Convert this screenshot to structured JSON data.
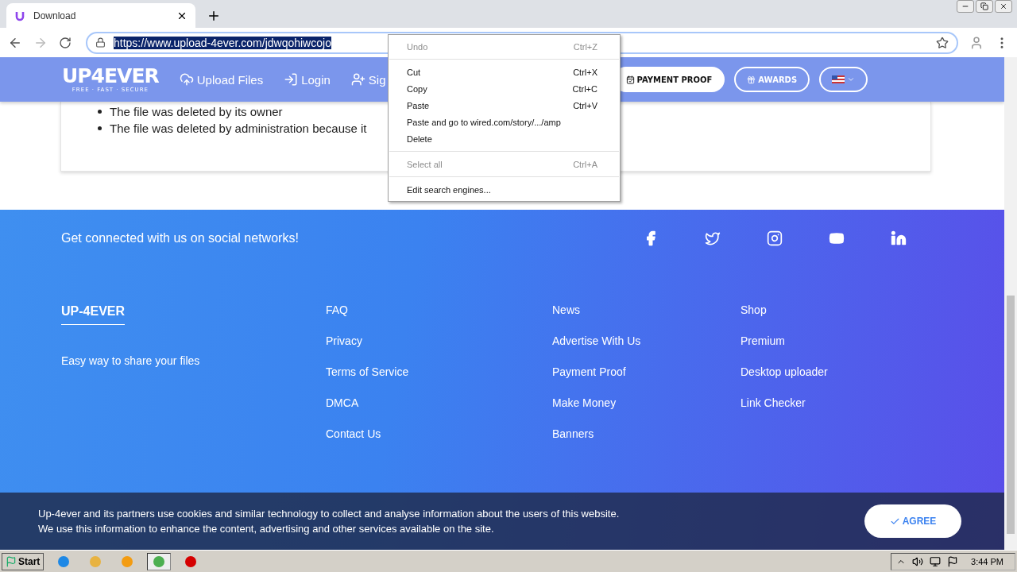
{
  "browser": {
    "tab": {
      "title": "Download",
      "selected": true
    },
    "url": "https://www.upload-4ever.com/jdwqohiwcojo",
    "url_selected": true
  },
  "header": {
    "logo": "UP4EVER",
    "tagline": "FREE · FAST · SECURE",
    "nav": [
      {
        "label": "Upload Files",
        "kind": "upload"
      },
      {
        "label": "Login",
        "kind": "login"
      },
      {
        "label": "Sig",
        "kind": "signup"
      }
    ],
    "pills": [
      {
        "label": "PAYMENT PROOF",
        "kind": "payment",
        "filled": true
      },
      {
        "label": "AWARDS",
        "kind": "awards",
        "filled": false
      },
      {
        "kind": "language",
        "filled": false
      }
    ]
  },
  "reasons": [
    "The file was deleted by its owner",
    "The file was deleted by administration because it"
  ],
  "context_menu": [
    {
      "label": "Undo",
      "shortcut": "Ctrl+Z",
      "disabled": true,
      "divider_after": true
    },
    {
      "label": "Cut",
      "shortcut": "Ctrl+X",
      "disabled": false,
      "divider_after": false
    },
    {
      "label": "Copy",
      "shortcut": "Ctrl+C",
      "disabled": false,
      "divider_after": false
    },
    {
      "label": "Paste",
      "shortcut": "Ctrl+V",
      "disabled": false,
      "divider_after": false
    },
    {
      "label": "Paste and go to wired.com/story/.../amp",
      "disabled": false,
      "divider_after": false
    },
    {
      "label": "Delete",
      "disabled": false,
      "divider_after": true
    },
    {
      "label": "Select all",
      "shortcut": "Ctrl+A",
      "disabled": true,
      "divider_after": true
    },
    {
      "label": "Edit search engines...",
      "disabled": false,
      "divider_after": false
    }
  ],
  "footer": {
    "social_title": "Get connected with us on social networks!",
    "social": [
      {
        "kind": "facebook"
      },
      {
        "kind": "twitter"
      },
      {
        "kind": "instagram"
      },
      {
        "kind": "youtube"
      },
      {
        "kind": "linkedin"
      }
    ],
    "brand": "UP-4EVER",
    "brand_text": "Easy way to share your files",
    "columns": [
      [
        "FAQ",
        "Privacy",
        "Terms of Service",
        "DMCA",
        "Contact Us"
      ],
      [
        "News",
        "Advertise With Us",
        "Payment Proof",
        "Make Money",
        "Banners"
      ],
      [
        "Shop",
        "Premium",
        "Desktop uploader",
        "Link Checker"
      ]
    ]
  },
  "cookie": {
    "lines": [
      "Up-4ever and its partners use cookies and similar technology to collect and analyse information about the users of this website.",
      "We use this information to enhance the content, advertising and other services available on the site."
    ],
    "button": "AGREE"
  },
  "taskbar": {
    "start": "Start",
    "apps": [
      {
        "kind": "ie",
        "selected": false
      },
      {
        "kind": "folder",
        "selected": false
      },
      {
        "kind": "media",
        "selected": false
      },
      {
        "kind": "chrome",
        "selected": true
      },
      {
        "kind": "stop",
        "selected": false
      }
    ],
    "time": "3:44 PM"
  }
}
